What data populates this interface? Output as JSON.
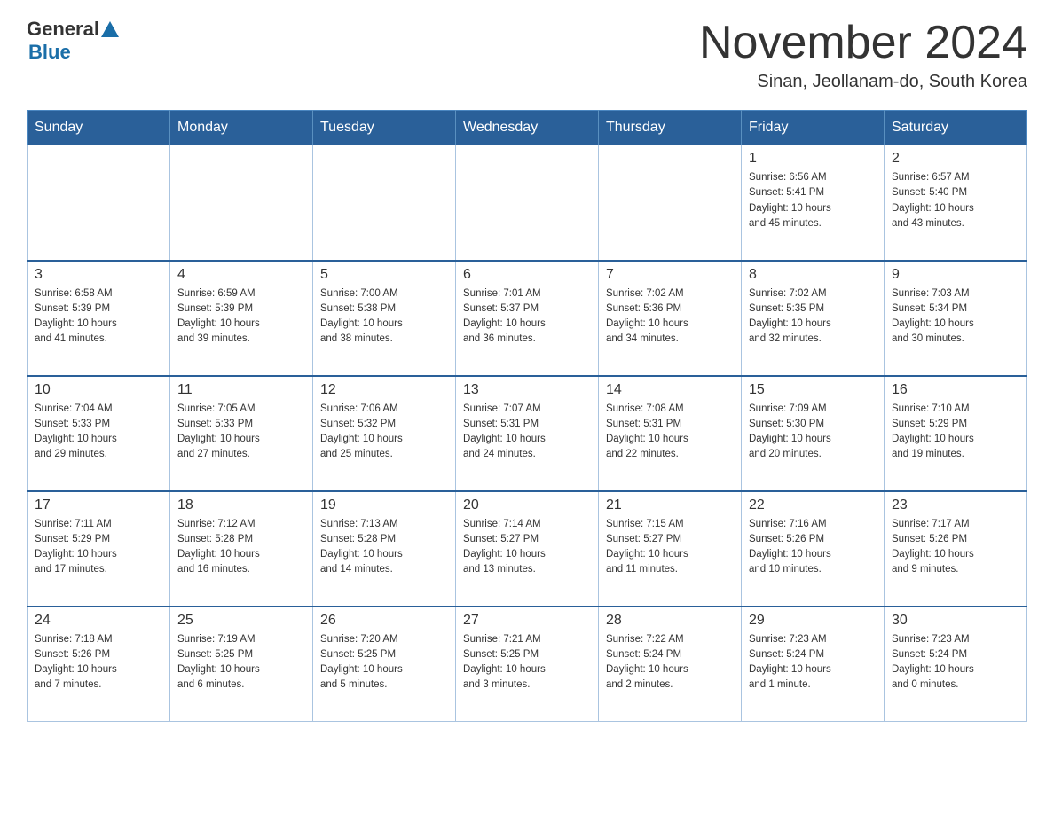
{
  "header": {
    "logo_general": "General",
    "logo_blue": "Blue",
    "month_title": "November 2024",
    "location": "Sinan, Jeollanam-do, South Korea"
  },
  "weekdays": [
    "Sunday",
    "Monday",
    "Tuesday",
    "Wednesday",
    "Thursday",
    "Friday",
    "Saturday"
  ],
  "weeks": [
    [
      {
        "day": "",
        "info": ""
      },
      {
        "day": "",
        "info": ""
      },
      {
        "day": "",
        "info": ""
      },
      {
        "day": "",
        "info": ""
      },
      {
        "day": "",
        "info": ""
      },
      {
        "day": "1",
        "info": "Sunrise: 6:56 AM\nSunset: 5:41 PM\nDaylight: 10 hours\nand 45 minutes."
      },
      {
        "day": "2",
        "info": "Sunrise: 6:57 AM\nSunset: 5:40 PM\nDaylight: 10 hours\nand 43 minutes."
      }
    ],
    [
      {
        "day": "3",
        "info": "Sunrise: 6:58 AM\nSunset: 5:39 PM\nDaylight: 10 hours\nand 41 minutes."
      },
      {
        "day": "4",
        "info": "Sunrise: 6:59 AM\nSunset: 5:39 PM\nDaylight: 10 hours\nand 39 minutes."
      },
      {
        "day": "5",
        "info": "Sunrise: 7:00 AM\nSunset: 5:38 PM\nDaylight: 10 hours\nand 38 minutes."
      },
      {
        "day": "6",
        "info": "Sunrise: 7:01 AM\nSunset: 5:37 PM\nDaylight: 10 hours\nand 36 minutes."
      },
      {
        "day": "7",
        "info": "Sunrise: 7:02 AM\nSunset: 5:36 PM\nDaylight: 10 hours\nand 34 minutes."
      },
      {
        "day": "8",
        "info": "Sunrise: 7:02 AM\nSunset: 5:35 PM\nDaylight: 10 hours\nand 32 minutes."
      },
      {
        "day": "9",
        "info": "Sunrise: 7:03 AM\nSunset: 5:34 PM\nDaylight: 10 hours\nand 30 minutes."
      }
    ],
    [
      {
        "day": "10",
        "info": "Sunrise: 7:04 AM\nSunset: 5:33 PM\nDaylight: 10 hours\nand 29 minutes."
      },
      {
        "day": "11",
        "info": "Sunrise: 7:05 AM\nSunset: 5:33 PM\nDaylight: 10 hours\nand 27 minutes."
      },
      {
        "day": "12",
        "info": "Sunrise: 7:06 AM\nSunset: 5:32 PM\nDaylight: 10 hours\nand 25 minutes."
      },
      {
        "day": "13",
        "info": "Sunrise: 7:07 AM\nSunset: 5:31 PM\nDaylight: 10 hours\nand 24 minutes."
      },
      {
        "day": "14",
        "info": "Sunrise: 7:08 AM\nSunset: 5:31 PM\nDaylight: 10 hours\nand 22 minutes."
      },
      {
        "day": "15",
        "info": "Sunrise: 7:09 AM\nSunset: 5:30 PM\nDaylight: 10 hours\nand 20 minutes."
      },
      {
        "day": "16",
        "info": "Sunrise: 7:10 AM\nSunset: 5:29 PM\nDaylight: 10 hours\nand 19 minutes."
      }
    ],
    [
      {
        "day": "17",
        "info": "Sunrise: 7:11 AM\nSunset: 5:29 PM\nDaylight: 10 hours\nand 17 minutes."
      },
      {
        "day": "18",
        "info": "Sunrise: 7:12 AM\nSunset: 5:28 PM\nDaylight: 10 hours\nand 16 minutes."
      },
      {
        "day": "19",
        "info": "Sunrise: 7:13 AM\nSunset: 5:28 PM\nDaylight: 10 hours\nand 14 minutes."
      },
      {
        "day": "20",
        "info": "Sunrise: 7:14 AM\nSunset: 5:27 PM\nDaylight: 10 hours\nand 13 minutes."
      },
      {
        "day": "21",
        "info": "Sunrise: 7:15 AM\nSunset: 5:27 PM\nDaylight: 10 hours\nand 11 minutes."
      },
      {
        "day": "22",
        "info": "Sunrise: 7:16 AM\nSunset: 5:26 PM\nDaylight: 10 hours\nand 10 minutes."
      },
      {
        "day": "23",
        "info": "Sunrise: 7:17 AM\nSunset: 5:26 PM\nDaylight: 10 hours\nand 9 minutes."
      }
    ],
    [
      {
        "day": "24",
        "info": "Sunrise: 7:18 AM\nSunset: 5:26 PM\nDaylight: 10 hours\nand 7 minutes."
      },
      {
        "day": "25",
        "info": "Sunrise: 7:19 AM\nSunset: 5:25 PM\nDaylight: 10 hours\nand 6 minutes."
      },
      {
        "day": "26",
        "info": "Sunrise: 7:20 AM\nSunset: 5:25 PM\nDaylight: 10 hours\nand 5 minutes."
      },
      {
        "day": "27",
        "info": "Sunrise: 7:21 AM\nSunset: 5:25 PM\nDaylight: 10 hours\nand 3 minutes."
      },
      {
        "day": "28",
        "info": "Sunrise: 7:22 AM\nSunset: 5:24 PM\nDaylight: 10 hours\nand 2 minutes."
      },
      {
        "day": "29",
        "info": "Sunrise: 7:23 AM\nSunset: 5:24 PM\nDaylight: 10 hours\nand 1 minute."
      },
      {
        "day": "30",
        "info": "Sunrise: 7:23 AM\nSunset: 5:24 PM\nDaylight: 10 hours\nand 0 minutes."
      }
    ]
  ]
}
